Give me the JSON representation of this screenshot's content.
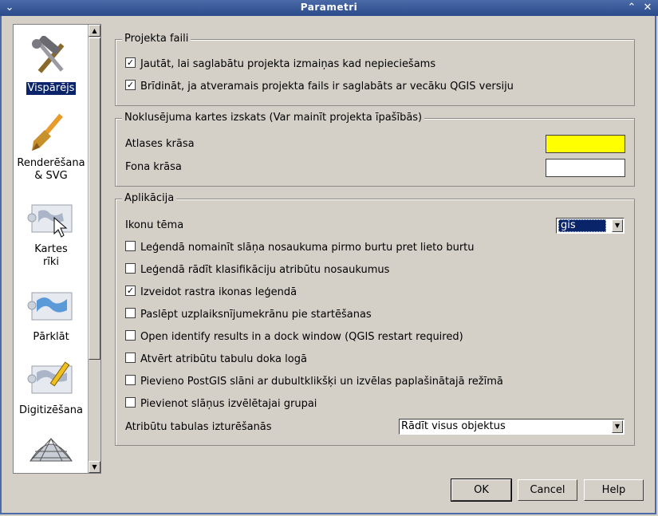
{
  "window": {
    "title": "Parametri"
  },
  "sidebar": {
    "items": [
      {
        "label": "Vispārējs",
        "icon": "hammer-wrench-icon",
        "selected": true
      },
      {
        "label_lines": [
          "Renderēšana",
          "& SVG"
        ],
        "icon": "paint-brush-icon"
      },
      {
        "label_lines": [
          "Kartes",
          "rīki"
        ],
        "icon": "map-pointer-icon"
      },
      {
        "label": "Pārklāt",
        "icon": "overlay-map-icon"
      },
      {
        "label": "Digitizēšana",
        "icon": "digitize-pencil-icon"
      },
      {
        "label": "",
        "icon": "globe-grid-icon"
      }
    ]
  },
  "project_files": {
    "title": "Projekta faili",
    "options": [
      {
        "label": "Jautāt, lai saglabātu projekta izmaiņas kad nepieciešams",
        "checked": true
      },
      {
        "label": "Brīdināt, ja atveramais projekta fails ir saglabāts ar vecāku QGIS versiju",
        "checked": true
      }
    ]
  },
  "map_defaults": {
    "title": "Noklusējuma kartes izskats (Var mainīt projekta īpašībās)",
    "selection_color_label": "Atlases krāsa",
    "selection_color": "#ffff00",
    "background_color_label": "Fona krāsa",
    "background_color": "#ffffff"
  },
  "application": {
    "title": "Aplikācija",
    "icon_theme_label": "Ikonu tēma",
    "icon_theme_value": "gis",
    "options": [
      {
        "label": "Leģendā nomainīt slāņa nosaukuma pirmo burtu pret lieto burtu",
        "checked": false
      },
      {
        "label": "Leģendā rādīt klasifikāciju atribūtu nosaukumus",
        "checked": false
      },
      {
        "label": "Izveidot rastra ikonas leģendā",
        "checked": true
      },
      {
        "label": "Paslēpt uzplaiksnījumekrānu pie startēšanas",
        "checked": false
      },
      {
        "label": "Open identify results in a dock window (QGIS restart required)",
        "checked": false
      },
      {
        "label": "Atvērt atribūtu tabulu doka logā",
        "checked": false
      },
      {
        "label": "Pievieno PostGIS slāni ar dubultklikšķi un izvēlas paplašinātajā režīmā",
        "checked": false
      },
      {
        "label": "Pievienot slāņus izvēlētajai grupai",
        "checked": false
      }
    ],
    "attr_table_label": "Atribūtu tabulas izturēšanās",
    "attr_table_value": "Rādīt visus objektus"
  },
  "buttons": {
    "ok": "OK",
    "cancel": "Cancel",
    "help": "Help"
  }
}
